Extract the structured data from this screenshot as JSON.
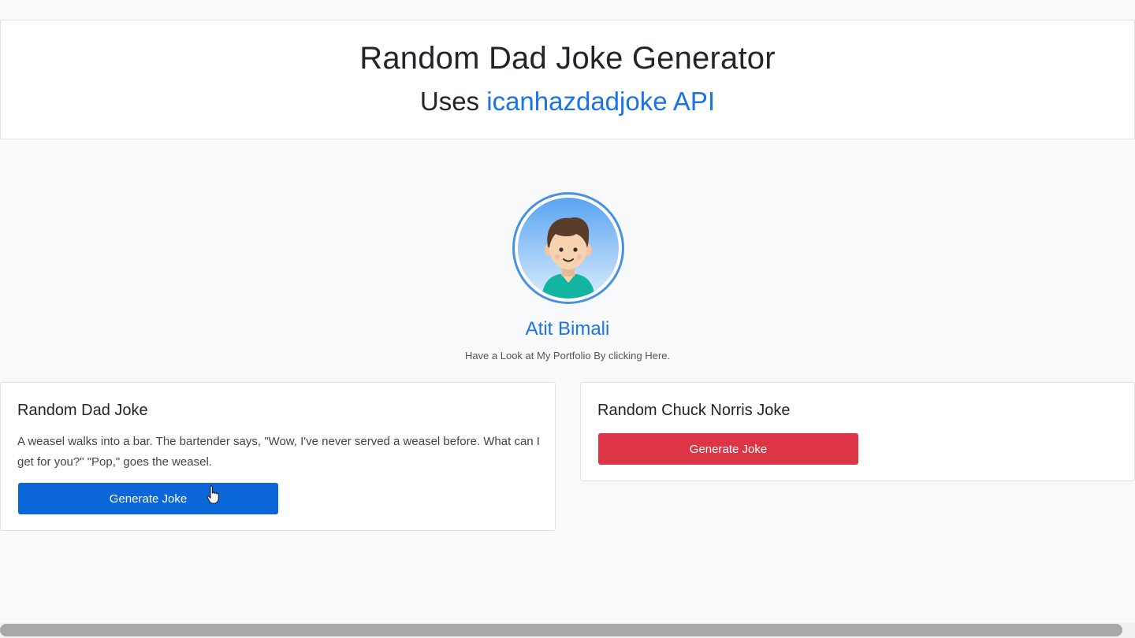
{
  "header": {
    "title": "Random Dad Joke Generator",
    "subtitle_prefix": "Uses ",
    "subtitle_link": "icanhazdadjoke API"
  },
  "profile": {
    "name": "Atit Bimali",
    "caption": "Have a Look at My Portfolio By clicking Here."
  },
  "dad_card": {
    "title": "Random Dad Joke",
    "joke": "A weasel walks into a bar. The bartender says, \"Wow, I've never served a weasel before. What can I get for you?\" \"Pop,\" goes the weasel.",
    "button_label": "Generate Joke"
  },
  "chuck_card": {
    "title": "Random Chuck Norris Joke",
    "button_label": "Generate Joke"
  },
  "colors": {
    "link": "#1a73e8",
    "primary_button": "#0b66d8",
    "danger_button": "#dc3545"
  }
}
